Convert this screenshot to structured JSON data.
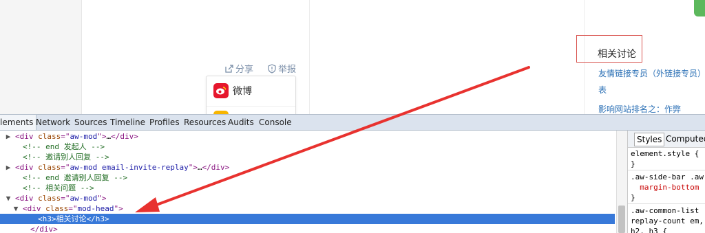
{
  "webpage": {
    "share_label": "分享",
    "report_label": "举报",
    "share_menu": {
      "weibo_label": "微博"
    },
    "related": {
      "title": "相关讨论",
      "links": [
        "友情链接专员（外链接专员）",
        "表",
        "影响网站排名之：作弊"
      ]
    },
    "colors": {
      "accent_green": "#5cb85c",
      "highlight_red": "#d9534f",
      "arrow_red": "#e8322f"
    }
  },
  "devtools": {
    "tabs": [
      "lements",
      "Network",
      "Sources",
      "Timeline",
      "Profiles",
      "Resources",
      "Audits",
      "Console"
    ],
    "dom_lines": [
      {
        "indent": 2,
        "triangle": "▶",
        "parts": [
          [
            "tag",
            "<div "
          ],
          [
            "attr",
            "class"
          ],
          [
            "tag",
            "=\""
          ],
          [
            "val",
            "aw-mod"
          ],
          [
            "tag",
            "\">"
          ],
          [
            "text",
            "…"
          ],
          [
            "tag",
            "</div>"
          ]
        ]
      },
      {
        "indent": 3,
        "triangle": "",
        "parts": [
          [
            "cmt",
            "<!-- end 发起人 -->"
          ]
        ]
      },
      {
        "indent": 3,
        "triangle": "",
        "parts": [
          [
            "cmt",
            "<!-- 邀请别人回复 -->"
          ]
        ]
      },
      {
        "indent": 2,
        "triangle": "▶",
        "parts": [
          [
            "tag",
            "<div "
          ],
          [
            "attr",
            "class"
          ],
          [
            "tag",
            "=\""
          ],
          [
            "val",
            "aw-mod email-invite-replay"
          ],
          [
            "tag",
            "\">"
          ],
          [
            "text",
            "…"
          ],
          [
            "tag",
            "</div>"
          ]
        ]
      },
      {
        "indent": 3,
        "triangle": "",
        "parts": [
          [
            "cmt",
            "<!-- end 邀请别人回复 -->"
          ]
        ]
      },
      {
        "indent": 3,
        "triangle": "",
        "parts": [
          [
            "cmt",
            "<!-- 相关问题 -->"
          ]
        ]
      },
      {
        "indent": 2,
        "triangle": "▼",
        "parts": [
          [
            "tag",
            "<div "
          ],
          [
            "attr",
            "class"
          ],
          [
            "tag",
            "=\""
          ],
          [
            "val",
            "aw-mod"
          ],
          [
            "tag",
            "\">"
          ]
        ]
      },
      {
        "indent": 3,
        "triangle": "▼",
        "parts": [
          [
            "tag",
            "<div "
          ],
          [
            "attr",
            "class"
          ],
          [
            "tag",
            "=\""
          ],
          [
            "val",
            "mod-head"
          ],
          [
            "tag",
            "\">"
          ]
        ]
      },
      {
        "indent": 5,
        "triangle": "",
        "selected": true,
        "parts": [
          [
            "tag",
            "<h3>"
          ],
          [
            "text",
            "相关讨论"
          ],
          [
            "tag",
            "</h3>"
          ]
        ]
      },
      {
        "indent": 4,
        "triangle": "",
        "parts": [
          [
            "tag",
            "</div>"
          ]
        ]
      }
    ],
    "side_tabs": [
      "Styles",
      "Computed"
    ],
    "styles": [
      {
        "text": "element.style {",
        "cls": ""
      },
      {
        "text": "}",
        "cls": ""
      },
      {
        "text": ".aw-side-bar .aw",
        "cls": ""
      },
      {
        "text": "  margin-bottom",
        "cls": "sp-red"
      },
      {
        "text": "}",
        "cls": ""
      },
      {
        "text": ".aw-common-list",
        "cls": ""
      },
      {
        "text": "replay-count em,",
        "cls": ""
      },
      {
        "text": "h2, h3 {",
        "cls": ""
      }
    ]
  }
}
